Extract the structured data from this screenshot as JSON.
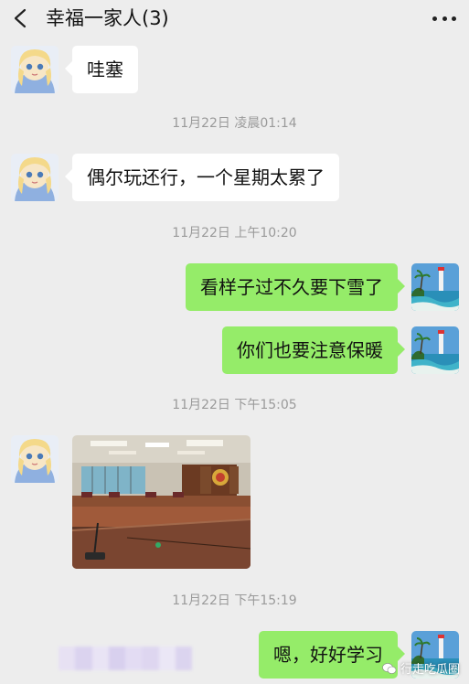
{
  "header": {
    "title": "幸福一家人(3)",
    "back_icon": "chevron-left-icon",
    "more_icon": "more-dots-icon"
  },
  "messages": [
    {
      "type": "text",
      "sender": "other",
      "text": "哇塞"
    },
    {
      "type": "timestamp",
      "text": "11月22日 凌晨01:14"
    },
    {
      "type": "text",
      "sender": "other",
      "text": "偶尔玩还行，一个星期太累了"
    },
    {
      "type": "timestamp",
      "text": "11月22日 上午10:20"
    },
    {
      "type": "text",
      "sender": "self",
      "text": "看样子过不久要下雪了"
    },
    {
      "type": "text",
      "sender": "self",
      "text": "你们也要注意保暖"
    },
    {
      "type": "timestamp",
      "text": "11月22日 下午15:05"
    },
    {
      "type": "image",
      "sender": "other"
    },
    {
      "type": "timestamp",
      "text": "11月22日 下午15:19"
    },
    {
      "type": "text",
      "sender": "self",
      "text": "嗯，好好学习"
    }
  ],
  "watermark": {
    "text": "行走吃瓜圈"
  },
  "colors": {
    "background": "#ededed",
    "incoming_bubble": "#ffffff",
    "outgoing_bubble": "#95ec69",
    "timestamp": "#9a9a9a"
  }
}
